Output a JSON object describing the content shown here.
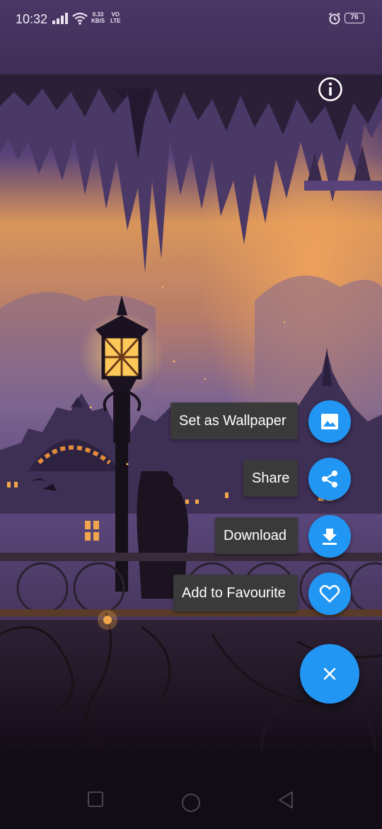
{
  "status_bar": {
    "time": "10:32",
    "net_speed_value": "0.33",
    "net_speed_unit": "KB/S",
    "volte_top": "VO",
    "volte_bottom": "LTE",
    "battery": "76"
  },
  "actions": {
    "set_wallpaper": "Set as Wallpaper",
    "share": "Share",
    "download": "Download",
    "favourite": "Add to Favourite"
  },
  "colors": {
    "fab": "#2196f3",
    "label_bg": "#3a3a3a",
    "status_bar": "#4c3766"
  },
  "icons": {
    "info": "info-icon",
    "set_wallpaper": "image-icon",
    "share": "share-icon",
    "download": "download-icon",
    "favourite": "heart-icon",
    "close": "close-icon"
  }
}
